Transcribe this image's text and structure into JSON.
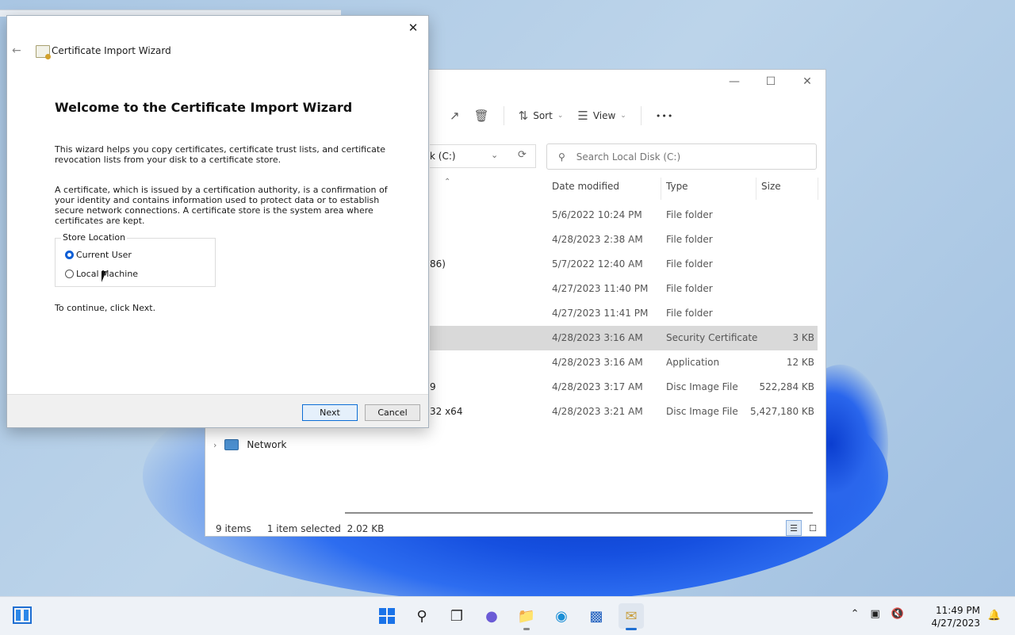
{
  "explorer": {
    "toolbar": {
      "sort_label": "Sort",
      "view_label": "View",
      "more_label": "•••"
    },
    "address_text": "k (C:)",
    "search_placeholder": "Search Local Disk (C:)",
    "columns": {
      "date": "Date modified",
      "type": "Type",
      "size": "Size"
    },
    "rows": [
      {
        "name": "",
        "date": "5/6/2022 10:24 PM",
        "type": "File folder",
        "size": ""
      },
      {
        "name": "",
        "date": "4/28/2023 2:38 AM",
        "type": "File folder",
        "size": ""
      },
      {
        "name": "86)",
        "date": "5/7/2022 12:40 AM",
        "type": "File folder",
        "size": ""
      },
      {
        "name": "",
        "date": "4/27/2023 11:40 PM",
        "type": "File folder",
        "size": ""
      },
      {
        "name": "",
        "date": "4/27/2023 11:41 PM",
        "type": "File folder",
        "size": ""
      },
      {
        "name": "",
        "date": "4/28/2023 3:16 AM",
        "type": "Security Certificate",
        "size": "3 KB"
      },
      {
        "name": "",
        "date": "4/28/2023 3:16 AM",
        "type": "Application",
        "size": "12 KB"
      },
      {
        "name": "9",
        "date": "4/28/2023 3:17 AM",
        "type": "Disc Image File",
        "size": "522,284 KB"
      },
      {
        "name": "32 x64",
        "date": "4/28/2023 3:21 AM",
        "type": "Disc Image File",
        "size": "5,427,180 KB"
      }
    ],
    "nav_network": "Network",
    "status": {
      "items": "9 items",
      "selected": "1 item selected",
      "size": "2.02 KB"
    }
  },
  "wizard": {
    "title": "Certificate Import Wizard",
    "heading": "Welcome to the Certificate Import Wizard",
    "paragraph1": "This wizard helps you copy certificates, certificate trust lists, and certificate revocation lists from your disk to a certificate store.",
    "paragraph2": "A certificate, which is issued by a certification authority, is a confirmation of your identity and contains information used to protect data or to establish secure network connections. A certificate store is the system area where certificates are kept.",
    "store_location_label": "Store Location",
    "options": {
      "current_user": "Current User",
      "local_machine": "Local Machine"
    },
    "selected_option": "Current User",
    "continue_text": "To continue, click Next.",
    "next_label": "Next",
    "cancel_label": "Cancel"
  },
  "taskbar": {
    "time": "11:49 PM",
    "date": "4/27/2023"
  },
  "colors": {
    "accent": "#1a73e8",
    "selected_row": "#d9d9d9"
  }
}
